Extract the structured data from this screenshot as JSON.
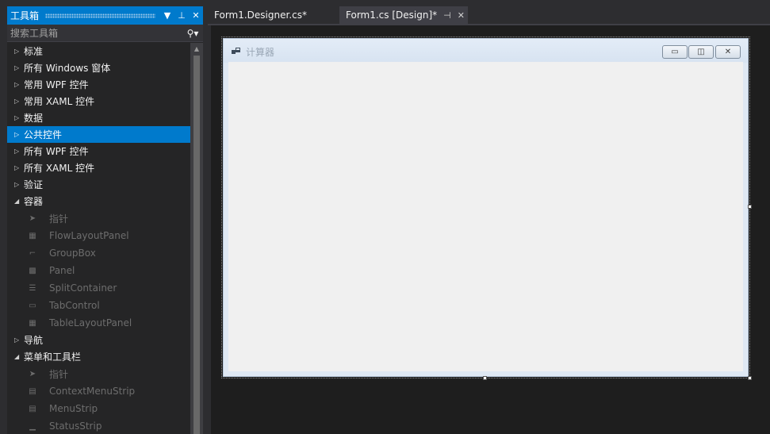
{
  "toolbox": {
    "title": "工具箱",
    "dropdown_icon": "▼",
    "pin_icon": "⊥",
    "close_icon": "✕",
    "search_placeholder": "搜索工具箱",
    "search_icon": "⚲▾",
    "categories_top": [
      {
        "label": "标准",
        "expanded": false
      },
      {
        "label": "所有 Windows 窗体",
        "expanded": false
      },
      {
        "label": "常用 WPF 控件",
        "expanded": false
      },
      {
        "label": "常用 XAML 控件",
        "expanded": false
      },
      {
        "label": "数据",
        "expanded": false
      },
      {
        "label": "公共控件",
        "expanded": false,
        "selected": true
      },
      {
        "label": "所有 WPF 控件",
        "expanded": false
      },
      {
        "label": "所有 XAML 控件",
        "expanded": false
      },
      {
        "label": "验证",
        "expanded": false
      }
    ],
    "container_category": {
      "label": "容器",
      "expanded": true
    },
    "container_items": [
      {
        "label": "指针",
        "icon": "pointer-icon"
      },
      {
        "label": "FlowLayoutPanel",
        "icon": "flowlayoutpanel-icon"
      },
      {
        "label": "GroupBox",
        "icon": "groupbox-icon"
      },
      {
        "label": "Panel",
        "icon": "panel-icon"
      },
      {
        "label": "SplitContainer",
        "icon": "splitcontainer-icon"
      },
      {
        "label": "TabControl",
        "icon": "tabcontrol-icon"
      },
      {
        "label": "TableLayoutPanel",
        "icon": "tablelayoutpanel-icon"
      }
    ],
    "nav_category": {
      "label": "导航",
      "expanded": false
    },
    "menu_category": {
      "label": "菜单和工具栏",
      "expanded": true
    },
    "menu_items": [
      {
        "label": "指针",
        "icon": "pointer-icon"
      },
      {
        "label": "ContextMenuStrip",
        "icon": "contextmenustrip-icon"
      },
      {
        "label": "MenuStrip",
        "icon": "menustrip-icon"
      },
      {
        "label": "StatusStrip",
        "icon": "statusstrip-icon"
      }
    ]
  },
  "tabs": {
    "tab1": "Form1.Designer.cs*",
    "tab2": "Form1.cs [Design]*",
    "tab2_pin": "⊣",
    "tab2_close": "✕"
  },
  "form": {
    "title": "计算器",
    "minimize_glyph": "▭",
    "maximize_glyph": "◫",
    "close_glyph": "✕"
  },
  "colors": {
    "accent": "#007acc",
    "panel_bg": "#252526",
    "designer_bg": "#1e1e1e",
    "form_client": "#f0f0f0"
  }
}
